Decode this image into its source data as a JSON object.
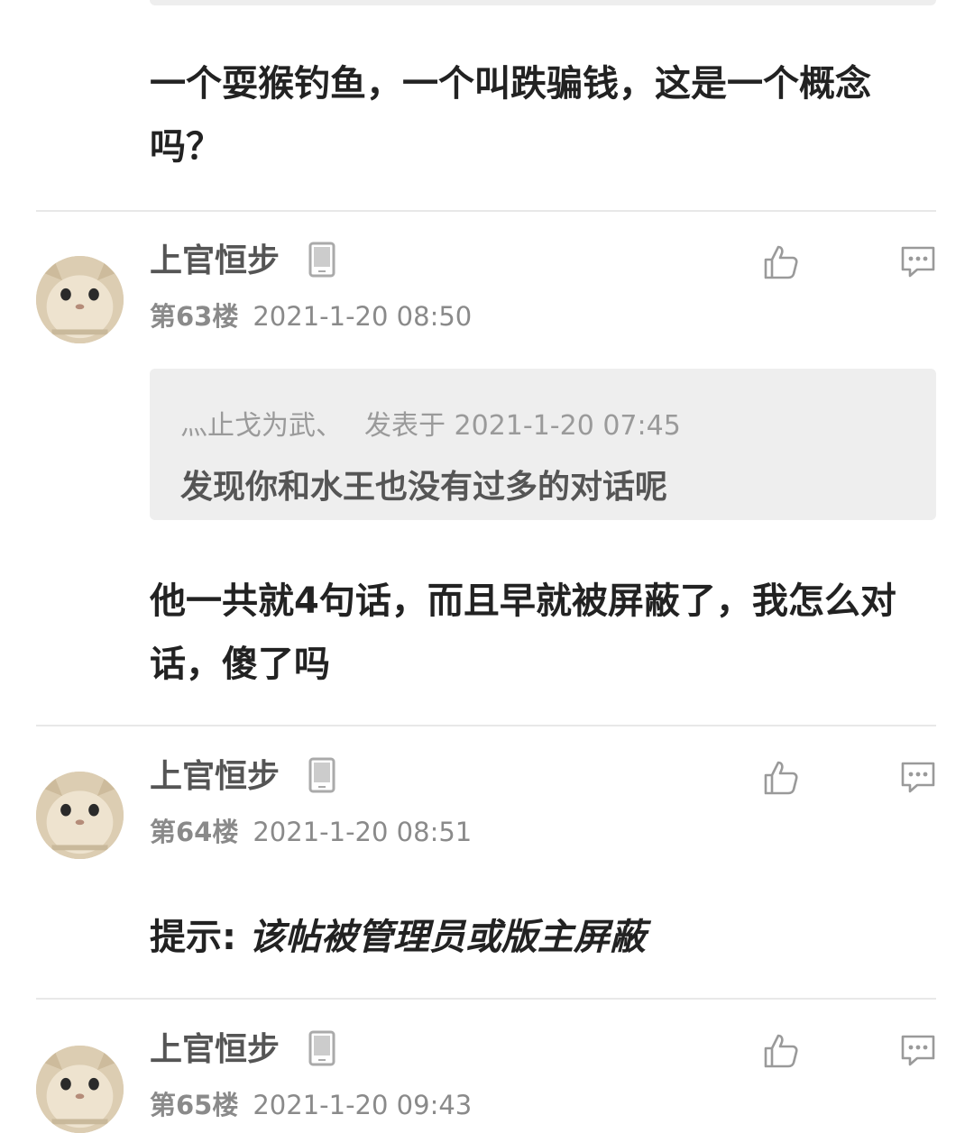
{
  "posts": [
    {
      "text": "一个耍猴钓鱼，一个叫跌骗钱，这是一个概念吗？"
    },
    {
      "username": "上官恒步",
      "floor": "第63楼",
      "time": "2021-1-20 08:50",
      "quote": {
        "author": "灬止戈为武、",
        "label": "发表于 2021-1-20 07:45",
        "text": "发现你和水王也没有过多的对话呢"
      },
      "text": "他一共就4句话，而且早就被屏蔽了，我怎么对话，傻了吗"
    },
    {
      "username": "上官恒步",
      "floor": "第64楼",
      "time": "2021-1-20 08:51",
      "notice_prefix": "提示: ",
      "notice_text": "该帖被管理员或版主屏蔽"
    },
    {
      "username": "上官恒步",
      "floor": "第65楼",
      "time": "2021-1-20 09:43"
    }
  ],
  "icons": {
    "device": "phone-icon",
    "like": "thumbs-up-icon",
    "reply": "comment-icon"
  },
  "colors": {
    "text": "#222222",
    "meta": "#8a8a8a",
    "quote_bg": "#eeeeee",
    "divider": "#e8e8e8"
  }
}
